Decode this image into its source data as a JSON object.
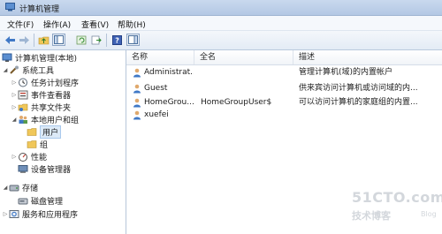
{
  "window": {
    "title": "计算机管理"
  },
  "menu": [
    "文件(F)",
    "操作(A)",
    "查看(V)",
    "帮助(H)"
  ],
  "tree": {
    "root": "计算机管理(本地)",
    "items": [
      {
        "label": "系统工具",
        "icon": "tools-icon"
      },
      {
        "label": "任务计划程序",
        "icon": "clock-icon"
      },
      {
        "label": "事件查看器",
        "icon": "event-viewer-icon"
      },
      {
        "label": "共享文件夹",
        "icon": "shared-folder-icon"
      },
      {
        "label": "本地用户和组",
        "icon": "users-group-icon"
      },
      {
        "label": "用户",
        "icon": "folder-icon"
      },
      {
        "label": "组",
        "icon": "folder-icon"
      },
      {
        "label": "性能",
        "icon": "performance-icon"
      },
      {
        "label": "设备管理器",
        "icon": "device-manager-icon"
      },
      {
        "label": "存储",
        "icon": "storage-icon"
      },
      {
        "label": "磁盘管理",
        "icon": "disk-icon"
      },
      {
        "label": "服务和应用程序",
        "icon": "services-icon"
      }
    ]
  },
  "list": {
    "columns": [
      "名称",
      "全名",
      "描述"
    ],
    "rows": [
      {
        "name": "Administrat...",
        "fullname": "",
        "desc": "管理计算机(域)的内置帐户"
      },
      {
        "name": "Guest",
        "fullname": "",
        "desc": "供来宾访问计算机或访问域的内..."
      },
      {
        "name": "HomeGrou...",
        "fullname": "HomeGroupUser$",
        "desc": "可以访问计算机的家庭组的内置..."
      },
      {
        "name": "xuefei",
        "fullname": "",
        "desc": ""
      }
    ]
  },
  "watermark": {
    "line1": "51CTO.com",
    "line2": "技术博客",
    "line3": "Blog"
  },
  "colors": {
    "accent": "#3f78c6",
    "selection": "#dceaf8",
    "folder": "#f0c75a"
  }
}
